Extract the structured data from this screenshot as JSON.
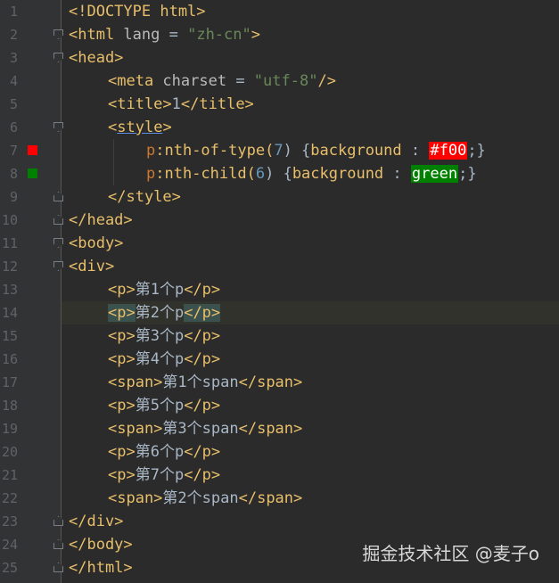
{
  "editor": {
    "theme_colors": {
      "background": "#2b2b2b",
      "gutter": "#313335",
      "tag": "#e8bf6a",
      "string": "#6a8759",
      "number": "#6897bb",
      "text": "#a9b7c6",
      "red_swatch": "#ff0000",
      "green_swatch": "#008000"
    },
    "lines": [
      {
        "num": "1",
        "parts": [
          "<!DOCTYPE html>"
        ]
      },
      {
        "num": "2",
        "parts": [
          "<html ",
          "lang",
          " = ",
          "\"zh-cn\"",
          ">"
        ]
      },
      {
        "num": "3",
        "parts": [
          "<head>"
        ]
      },
      {
        "num": "4",
        "parts": [
          "<meta ",
          "charset",
          " = ",
          "\"utf-8\"",
          "/>"
        ]
      },
      {
        "num": "5",
        "parts": [
          "<title>",
          "1",
          "</title>"
        ]
      },
      {
        "num": "6",
        "parts": [
          "<",
          "style",
          ">"
        ]
      },
      {
        "num": "7",
        "parts": [
          "p",
          ":nth-of-type(",
          "7",
          ") {",
          "background",
          " : ",
          "#f00",
          ";}"
        ]
      },
      {
        "num": "8",
        "parts": [
          "p",
          ":nth-child(",
          "6",
          ") {",
          "background",
          " : ",
          "green",
          ";}"
        ]
      },
      {
        "num": "9",
        "parts": [
          "</style>"
        ]
      },
      {
        "num": "10",
        "parts": [
          "</head>"
        ]
      },
      {
        "num": "11",
        "parts": [
          "<body>"
        ]
      },
      {
        "num": "12",
        "parts": [
          "<div>"
        ]
      },
      {
        "num": "13",
        "parts": [
          "<p>",
          "第1个p",
          "</p>"
        ]
      },
      {
        "num": "14",
        "parts": [
          "<p>",
          "第2个p",
          "</p>"
        ]
      },
      {
        "num": "15",
        "parts": [
          "<p>",
          "第3个p",
          "</p>"
        ]
      },
      {
        "num": "16",
        "parts": [
          "<p>",
          "第4个p",
          "</p>"
        ]
      },
      {
        "num": "17",
        "parts": [
          "<span>",
          "第1个span",
          "</span>"
        ]
      },
      {
        "num": "18",
        "parts": [
          "<p>",
          "第5个p",
          "</p>"
        ]
      },
      {
        "num": "19",
        "parts": [
          "<span>",
          "第3个span",
          "</span>"
        ]
      },
      {
        "num": "20",
        "parts": [
          "<p>",
          "第6个p",
          "</p>"
        ]
      },
      {
        "num": "21",
        "parts": [
          "<p>",
          "第7个p",
          "</p>"
        ]
      },
      {
        "num": "22",
        "parts": [
          "<span>",
          "第2个span",
          "</span>"
        ]
      },
      {
        "num": "23",
        "parts": [
          "</div>"
        ]
      },
      {
        "num": "24",
        "parts": [
          "</body>"
        ]
      },
      {
        "num": "25",
        "parts": [
          "</html>"
        ]
      }
    ]
  },
  "watermark": "掘金技术社区 @麦子o"
}
